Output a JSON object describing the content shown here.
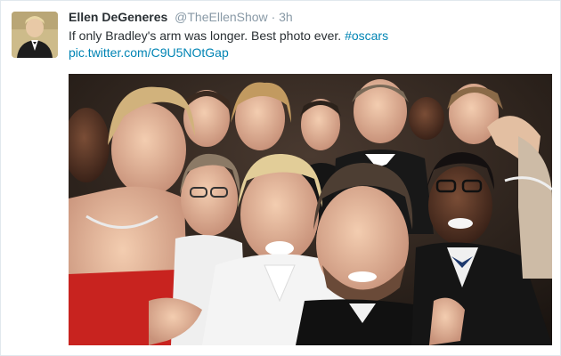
{
  "tweet": {
    "name": "Ellen DeGeneres",
    "handle": "@TheEllenShow",
    "separator": "·",
    "time": "3h",
    "text": "If only Bradley's arm was longer. Best photo ever.",
    "hashtag": "#oscars",
    "link": "pic.twitter.com/C9U5NOtGap"
  },
  "icons": {
    "avatar": "user-avatar",
    "photo": "selfie-photo"
  },
  "colors": {
    "link": "#0084b4",
    "name": "#292f33",
    "meta": "#8899a6"
  }
}
